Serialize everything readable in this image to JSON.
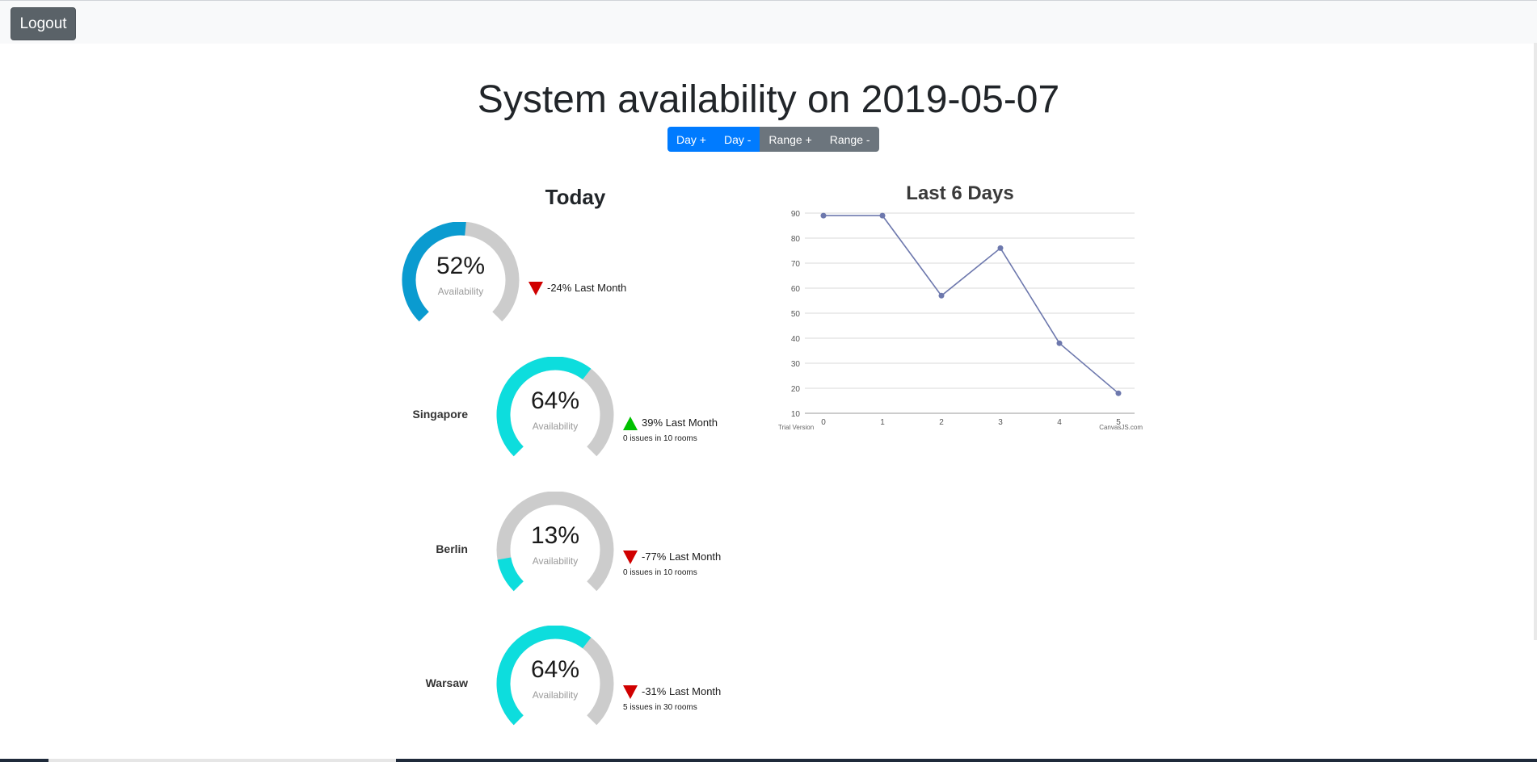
{
  "header": {
    "logout_label": "Logout"
  },
  "page": {
    "title": "System availability on 2019-05-07"
  },
  "controls": {
    "day_plus": "Day +",
    "day_minus": "Day -",
    "range_plus": "Range +",
    "range_minus": "Range -"
  },
  "today": {
    "title": "Today",
    "overall": {
      "value_text": "52%",
      "value": 52,
      "sub": "Availability",
      "trend": "-24% Last Month",
      "trend_dir": "down",
      "color": "#0a9bd0"
    },
    "cities": [
      {
        "name": "Singapore",
        "value_text": "64%",
        "value": 64,
        "sub": "Availability",
        "trend": "39% Last Month",
        "trend_dir": "up",
        "issues": "0 issues in 10 rooms",
        "color": "#0ddddd"
      },
      {
        "name": "Berlin",
        "value_text": "13%",
        "value": 13,
        "sub": "Availability",
        "trend": "-77% Last Month",
        "trend_dir": "down",
        "issues": "0 issues in 10 rooms",
        "color": "#0ddddd"
      },
      {
        "name": "Warsaw",
        "value_text": "64%",
        "value": 64,
        "sub": "Availability",
        "trend": "-31% Last Month",
        "trend_dir": "down",
        "issues": "5 issues in 30 rooms",
        "color": "#0ddddd"
      }
    ]
  },
  "chart_data": {
    "type": "line",
    "title": "Last 6 Days",
    "x": [
      0,
      1,
      2,
      3,
      4,
      5
    ],
    "series": [
      {
        "values": [
          89,
          89,
          57,
          76,
          38,
          18
        ]
      }
    ],
    "ylim": [
      10,
      90
    ],
    "yticks": [
      10,
      20,
      30,
      40,
      50,
      60,
      70,
      80,
      90
    ],
    "grid": true,
    "line_color": "#6d78ad",
    "watermark_left": "Trial Version",
    "watermark_right": "CanvasJS.com"
  }
}
